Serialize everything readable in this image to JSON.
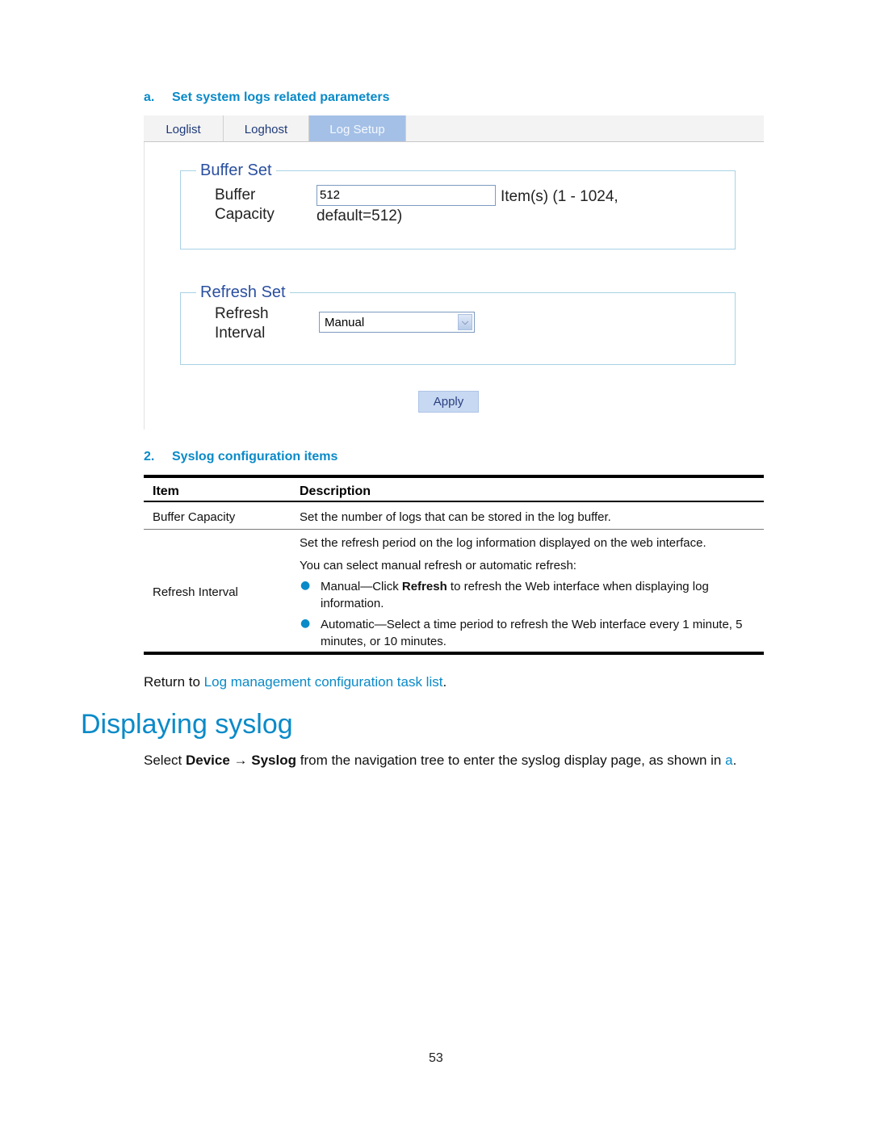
{
  "figure_caption": {
    "label": "a.",
    "title": "Set system logs related parameters"
  },
  "tabs": [
    {
      "label": "Loglist",
      "active": false
    },
    {
      "label": "Loghost",
      "active": false
    },
    {
      "label": "Log Setup",
      "active": true
    }
  ],
  "buffer_set": {
    "legend": "Buffer Set",
    "label_line1": "Buffer",
    "label_line2": "Capacity",
    "value": "512",
    "hint_line1": "Item(s) (1 - 1024,",
    "hint_line2": "default=512)"
  },
  "refresh_set": {
    "legend": "Refresh Set",
    "label_line1": "Refresh",
    "label_line2": "Interval",
    "selected": "Manual"
  },
  "apply_label": "Apply",
  "table_caption": {
    "label": "2.",
    "title": "Syslog configuration items"
  },
  "table": {
    "headers": [
      "Item",
      "Description"
    ],
    "rows": [
      {
        "item": "Buffer Capacity",
        "desc": "Set the number of logs that can be stored in the log buffer."
      },
      {
        "item": "Refresh Interval",
        "desc_line1": "Set the refresh period on the log information displayed on the web interface.",
        "desc_line2": "You can select manual refresh or automatic refresh:",
        "bullets": [
          {
            "pre": "Manual—Click ",
            "bold": "Refresh",
            "post": " to refresh the Web interface when displaying log",
            "cont": "information."
          },
          {
            "pre": "Automatic—Select a time period to refresh the Web interface every 1 minute, 5",
            "bold": "",
            "post": "",
            "cont": "minutes, or 10 minutes."
          }
        ]
      }
    ]
  },
  "return_text": "Return to ",
  "return_link": "Log management configuration task list",
  "return_end": ".",
  "section_heading": "Displaying syslog",
  "section_body": {
    "pre": "Select ",
    "b1": "Device",
    "arrow": " → ",
    "b2": "Syslog",
    "mid": " from the navigation tree to enter the syslog display page, as shown in ",
    "link": "a",
    "end": "."
  },
  "page_number": "53"
}
